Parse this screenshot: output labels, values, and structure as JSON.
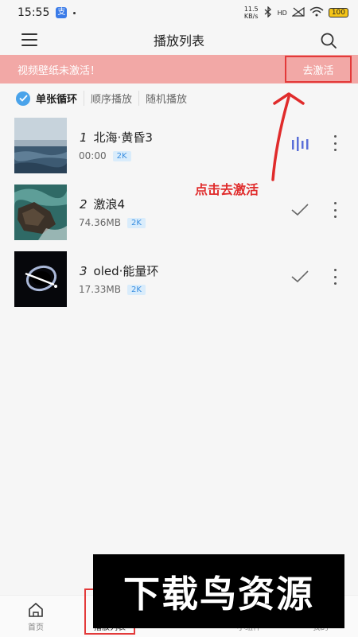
{
  "status": {
    "time": "15:55",
    "app_badge": "支",
    "net_speed_value": "11.5",
    "net_speed_unit": "KB/s",
    "network": "HD",
    "battery": "100"
  },
  "header": {
    "title": "播放列表"
  },
  "notice": {
    "text": "视频壁纸未激活！",
    "action_label": "去激活"
  },
  "modes": {
    "single_loop": "单张循环",
    "sequential": "顺序播放",
    "random": "随机播放"
  },
  "tracks": [
    {
      "num": "1",
      "title": "北海·黄昏3",
      "meta": "00:00",
      "res": "2K",
      "state": "playing"
    },
    {
      "num": "2",
      "title": "激浪4",
      "meta": "74.36MB",
      "res": "2K",
      "state": "downloaded"
    },
    {
      "num": "3",
      "title": "oled·能量环",
      "meta": "17.33MB",
      "res": "2K",
      "state": "downloaded"
    }
  ],
  "annotation": {
    "label": "点击去激活"
  },
  "tabs": [
    {
      "label": "首页"
    },
    {
      "label": "播放列表"
    },
    {
      "label": "小组件"
    },
    {
      "label": "我的"
    }
  ],
  "watermark": {
    "text": "下载鸟资源"
  },
  "colors": {
    "notice_bg": "#f2a8a6",
    "accent": "#4aa3ea",
    "annotation_red": "#e02b2b",
    "playing_bars": "#5a6fd8"
  }
}
